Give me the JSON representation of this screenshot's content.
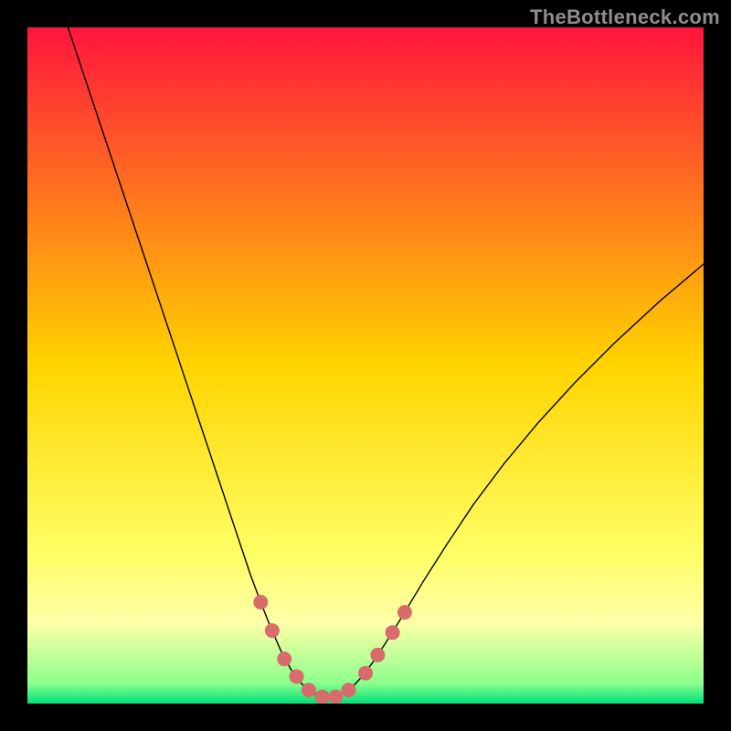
{
  "watermark": "TheBottleneck.com",
  "chart_data": {
    "type": "line",
    "title": "",
    "xlabel": "",
    "ylabel": "",
    "xlim": [
      0,
      1
    ],
    "ylim": [
      0,
      1
    ],
    "background_gradient": {
      "stops": [
        {
          "offset": 0.0,
          "color": "#ff153d"
        },
        {
          "offset": 0.5,
          "color": "#ffd400"
        },
        {
          "offset": 0.78,
          "color": "#ffff66"
        },
        {
          "offset": 0.88,
          "color": "#ffffa8"
        },
        {
          "offset": 0.97,
          "color": "#8cff8c"
        },
        {
          "offset": 1.0,
          "color": "#00e07a"
        }
      ]
    },
    "series": [
      {
        "name": "bottleneck-curve",
        "color": "#000000",
        "width": 1.4,
        "points": [
          {
            "x": 0.06,
            "y": 1.0
          },
          {
            "x": 0.075,
            "y": 0.955
          },
          {
            "x": 0.09,
            "y": 0.91
          },
          {
            "x": 0.105,
            "y": 0.865
          },
          {
            "x": 0.12,
            "y": 0.82
          },
          {
            "x": 0.135,
            "y": 0.775
          },
          {
            "x": 0.15,
            "y": 0.73
          },
          {
            "x": 0.165,
            "y": 0.685
          },
          {
            "x": 0.18,
            "y": 0.64
          },
          {
            "x": 0.195,
            "y": 0.595
          },
          {
            "x": 0.21,
            "y": 0.55
          },
          {
            "x": 0.225,
            "y": 0.505
          },
          {
            "x": 0.24,
            "y": 0.46
          },
          {
            "x": 0.255,
            "y": 0.415
          },
          {
            "x": 0.27,
            "y": 0.37
          },
          {
            "x": 0.285,
            "y": 0.325
          },
          {
            "x": 0.3,
            "y": 0.28
          },
          {
            "x": 0.315,
            "y": 0.235
          },
          {
            "x": 0.33,
            "y": 0.19
          },
          {
            "x": 0.345,
            "y": 0.15
          },
          {
            "x": 0.36,
            "y": 0.112
          },
          {
            "x": 0.375,
            "y": 0.078
          },
          {
            "x": 0.39,
            "y": 0.05
          },
          {
            "x": 0.405,
            "y": 0.03
          },
          {
            "x": 0.42,
            "y": 0.016
          },
          {
            "x": 0.435,
            "y": 0.01
          },
          {
            "x": 0.45,
            "y": 0.01
          },
          {
            "x": 0.465,
            "y": 0.014
          },
          {
            "x": 0.48,
            "y": 0.024
          },
          {
            "x": 0.495,
            "y": 0.04
          },
          {
            "x": 0.51,
            "y": 0.06
          },
          {
            "x": 0.53,
            "y": 0.09
          },
          {
            "x": 0.555,
            "y": 0.13
          },
          {
            "x": 0.585,
            "y": 0.18
          },
          {
            "x": 0.62,
            "y": 0.235
          },
          {
            "x": 0.66,
            "y": 0.295
          },
          {
            "x": 0.705,
            "y": 0.355
          },
          {
            "x": 0.755,
            "y": 0.415
          },
          {
            "x": 0.81,
            "y": 0.475
          },
          {
            "x": 0.87,
            "y": 0.535
          },
          {
            "x": 0.935,
            "y": 0.595
          },
          {
            "x": 1.0,
            "y": 0.65
          }
        ]
      },
      {
        "name": "near-optimal-markers",
        "color": "#d86b6b",
        "marker_radius": 8,
        "points": [
          {
            "x": 0.345,
            "y": 0.15
          },
          {
            "x": 0.362,
            "y": 0.108
          },
          {
            "x": 0.38,
            "y": 0.066
          },
          {
            "x": 0.398,
            "y": 0.04
          },
          {
            "x": 0.416,
            "y": 0.02
          },
          {
            "x": 0.436,
            "y": 0.01
          },
          {
            "x": 0.456,
            "y": 0.01
          },
          {
            "x": 0.475,
            "y": 0.02
          },
          {
            "x": 0.5,
            "y": 0.045
          },
          {
            "x": 0.518,
            "y": 0.072
          },
          {
            "x": 0.54,
            "y": 0.105
          },
          {
            "x": 0.558,
            "y": 0.135
          }
        ]
      }
    ]
  }
}
